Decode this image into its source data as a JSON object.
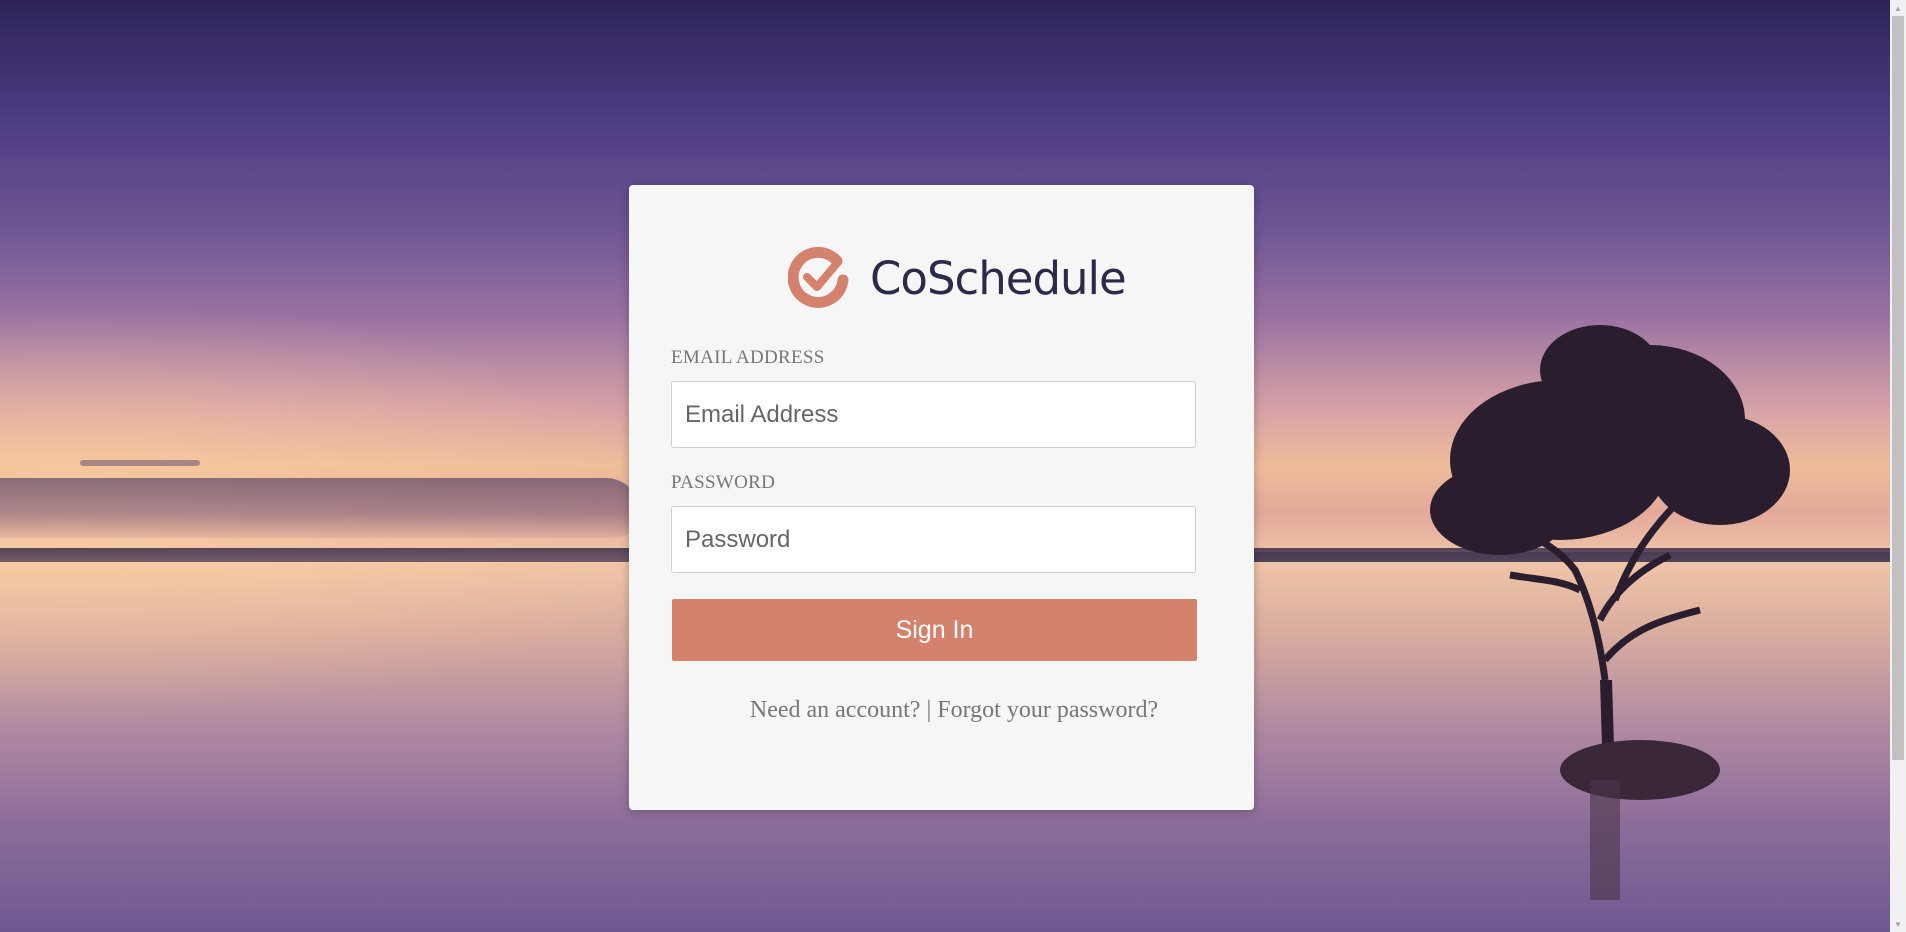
{
  "brand": {
    "name": "CoSchedule",
    "logo_icon": "coschedule-check-logo",
    "accent_color": "#d4826e",
    "text_color": "#2b2a48"
  },
  "form": {
    "email": {
      "label": "EMAIL ADDRESS",
      "placeholder": "Email Address",
      "value": ""
    },
    "password": {
      "label": "PASSWORD",
      "placeholder": "Password",
      "value": ""
    },
    "submit_label": "Sign In"
  },
  "footer_links": {
    "need_account": "Need an account?",
    "separator": " | ",
    "forgot_password": "Forgot your password?"
  }
}
